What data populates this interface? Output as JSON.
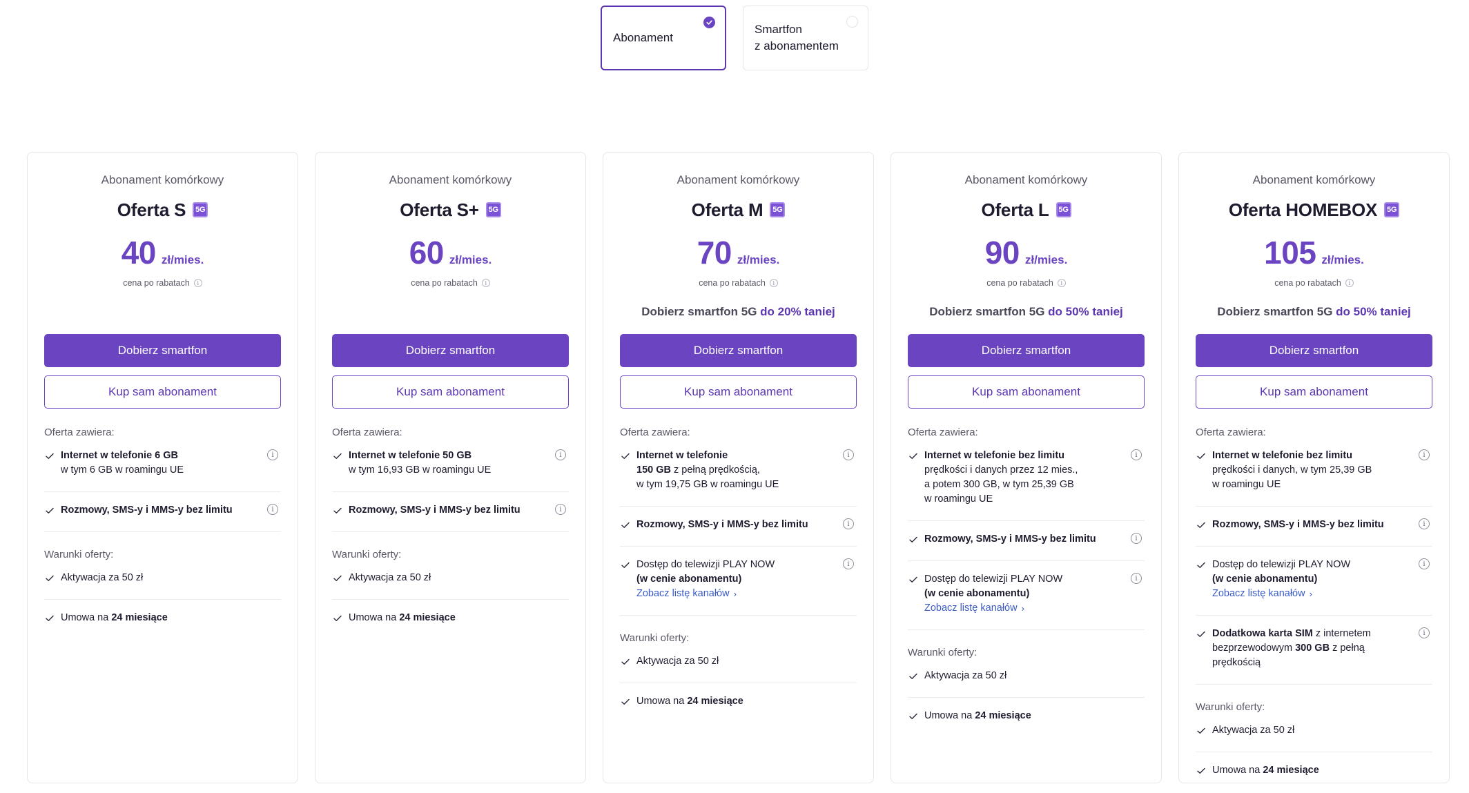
{
  "toggle": {
    "options": [
      {
        "label": "Abonament",
        "selected": true
      },
      {
        "label": "Smartfon\nz abonamentem",
        "selected": false
      }
    ]
  },
  "colors": {
    "accent": "#6b44c2",
    "link": "#3a5bc7",
    "border": "#e6e5ec"
  },
  "cards": [
    {
      "subtitle": "Abonament komórkowy",
      "title": "Oferta S",
      "badge": "5G",
      "price": "40",
      "price_unit": "zł/mies.",
      "price_note": "cena po rabatach",
      "promo_text": "",
      "promo_highlight": "",
      "primary_button": "Dobierz smartfon",
      "secondary_button": "Kup sam abonament",
      "features_label": "Oferta zawiera:",
      "features": [
        {
          "bold": "Internet w telefonie 6 GB",
          "rest": "\nw tym 6 GB w roamingu UE",
          "info": true
        },
        {
          "bold": "Rozmowy, SMS-y i MMS-y bez limitu",
          "rest": "",
          "info": true
        }
      ],
      "conditions_label": "Warunki oferty:",
      "conditions": [
        {
          "text": "Aktywacja za 50 zł",
          "bold": ""
        },
        {
          "text": "Umowa na ",
          "bold": "24 miesiące"
        }
      ]
    },
    {
      "subtitle": "Abonament komórkowy",
      "title": "Oferta S+",
      "badge": "5G",
      "price": "60",
      "price_unit": "zł/mies.",
      "price_note": "cena po rabatach",
      "promo_text": "",
      "promo_highlight": "",
      "primary_button": "Dobierz smartfon",
      "secondary_button": "Kup sam abonament",
      "features_label": "Oferta zawiera:",
      "features": [
        {
          "bold": "Internet w telefonie 50 GB",
          "rest": "\nw tym 16,93 GB w roamingu UE",
          "info": true
        },
        {
          "bold": "Rozmowy, SMS-y i MMS-y bez limitu",
          "rest": "",
          "info": true
        }
      ],
      "conditions_label": "Warunki oferty:",
      "conditions": [
        {
          "text": "Aktywacja za 50 zł",
          "bold": ""
        },
        {
          "text": "Umowa na ",
          "bold": "24 miesiące"
        }
      ]
    },
    {
      "subtitle": "Abonament komórkowy",
      "title": "Oferta M",
      "badge": "5G",
      "price": "70",
      "price_unit": "zł/mies.",
      "price_note": "cena po rabatach",
      "promo_text": "Dobierz smartfon 5G ",
      "promo_highlight": "do 20% taniej",
      "primary_button": "Dobierz smartfon",
      "secondary_button": "Kup sam abonament",
      "features_label": "Oferta zawiera:",
      "features": [
        {
          "bold": "Internet w telefonie\n150 GB",
          "rest": " z pełną prędkością,\nw tym 19,75 GB w roamingu UE",
          "info": true
        },
        {
          "bold": "Rozmowy, SMS-y i MMS-y bez limitu",
          "rest": "",
          "info": true
        },
        {
          "bold": "",
          "rest": "Dostęp do telewizji PLAY NOW",
          "bold2": "\n(w cenie abonamentu)",
          "link": "Zobacz listę kanałów",
          "info": true
        }
      ],
      "conditions_label": "Warunki oferty:",
      "conditions": [
        {
          "text": "Aktywacja za 50 zł",
          "bold": ""
        },
        {
          "text": "Umowa na ",
          "bold": "24 miesiące"
        }
      ]
    },
    {
      "subtitle": "Abonament komórkowy",
      "title": "Oferta L",
      "badge": "5G",
      "price": "90",
      "price_unit": "zł/mies.",
      "price_note": "cena po rabatach",
      "promo_text": "Dobierz smartfon 5G ",
      "promo_highlight": "do 50% taniej",
      "primary_button": "Dobierz smartfon",
      "secondary_button": "Kup sam abonament",
      "features_label": "Oferta zawiera:",
      "features": [
        {
          "bold": "Internet w telefonie bez limitu",
          "rest": "\nprędkości i danych przez 12 mies.,\na potem 300 GB, w tym 25,39 GB\n w roamingu UE",
          "info": true
        },
        {
          "bold": "Rozmowy, SMS-y i MMS-y bez limitu",
          "rest": "",
          "info": true
        },
        {
          "bold": "",
          "rest": "Dostęp do telewizji PLAY NOW",
          "bold2": "\n(w cenie abonamentu)",
          "link": "Zobacz listę kanałów",
          "info": true
        }
      ],
      "conditions_label": "Warunki oferty:",
      "conditions": [
        {
          "text": "Aktywacja za 50 zł",
          "bold": ""
        },
        {
          "text": "Umowa na ",
          "bold": "24 miesiące"
        }
      ]
    },
    {
      "subtitle": "Abonament komórkowy",
      "title": "Oferta HOMEBOX",
      "badge": "5G",
      "price": "105",
      "price_unit": "zł/mies.",
      "price_note": "cena po rabatach",
      "promo_text": "Dobierz smartfon 5G ",
      "promo_highlight": "do 50% taniej",
      "primary_button": "Dobierz smartfon",
      "secondary_button": "Kup sam abonament",
      "features_label": "Oferta zawiera:",
      "features": [
        {
          "bold": "Internet w telefonie bez limitu",
          "rest": "\nprędkości i danych, w tym 25,39 GB\nw roamingu UE",
          "info": true
        },
        {
          "bold": "Rozmowy, SMS-y i MMS-y bez limitu",
          "rest": "",
          "info": true
        },
        {
          "bold": "",
          "rest": "Dostęp do telewizji PLAY NOW",
          "bold2": "\n(w cenie abonamentu)",
          "link": "Zobacz listę kanałów",
          "info": true
        },
        {
          "bold": "Dodatkowa karta SIM",
          "rest": " z internetem\nbezprzewodowym ",
          "bold3": "300 GB",
          "rest2": " z pełną\nprędkością",
          "info": true
        }
      ],
      "conditions_label": "Warunki oferty:",
      "conditions": [
        {
          "text": "Aktywacja za 50 zł",
          "bold": ""
        },
        {
          "text": "Umowa na ",
          "bold": "24 miesiące"
        }
      ]
    }
  ]
}
